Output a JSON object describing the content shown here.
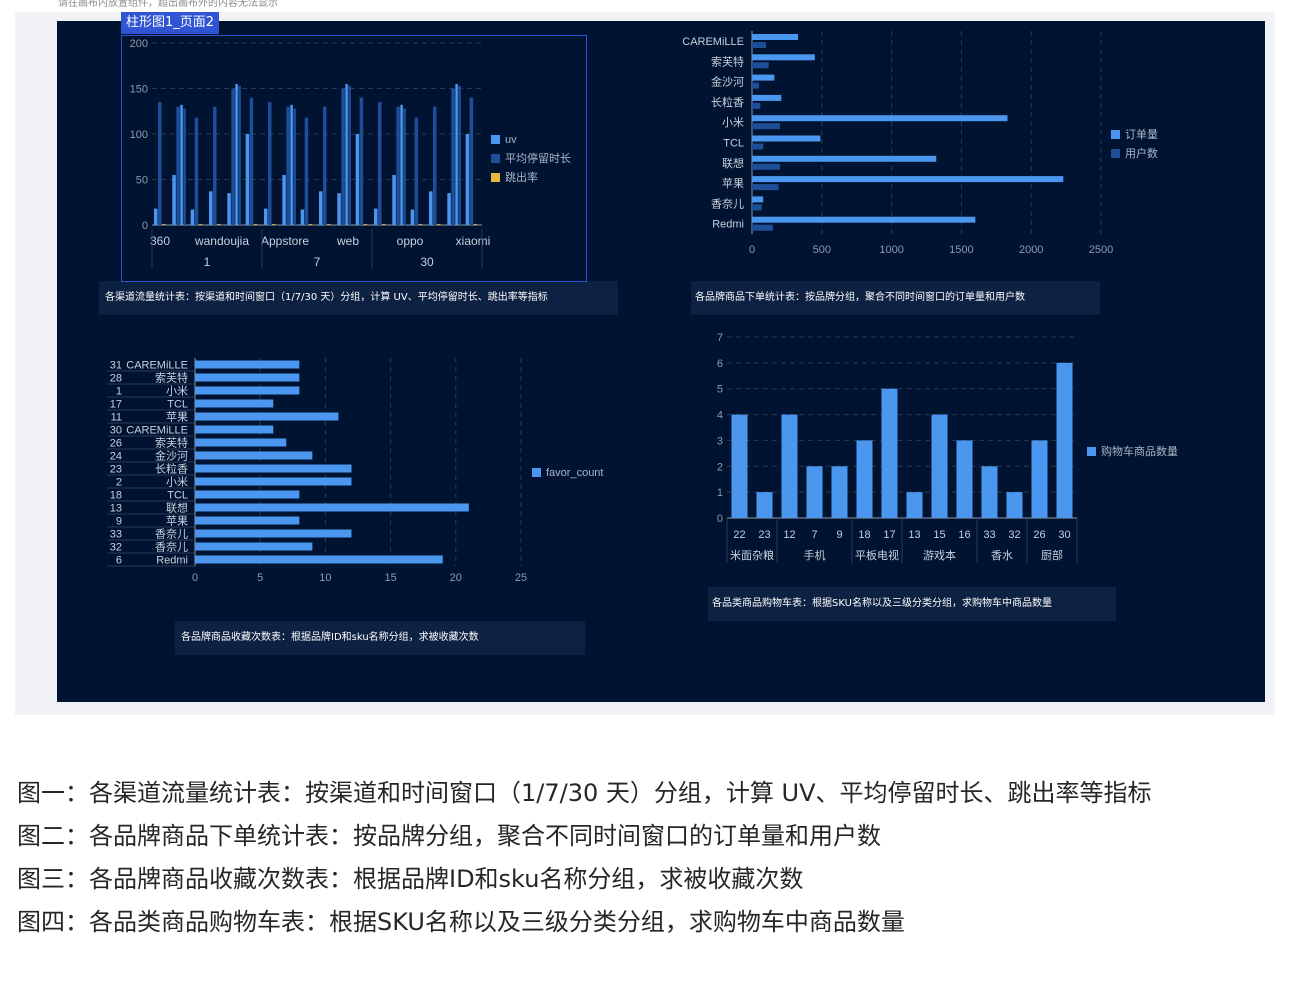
{
  "hint": "请在画布内放置组件，超出画布外的内容无法显示",
  "selected_label": "柱形图1_页面2",
  "colors": {
    "c1": "#4b97ef",
    "c2": "#1f4e99",
    "c3": "#e5b940",
    "axis": "#8e9aab",
    "grid": "#2a3a55"
  },
  "captions": {
    "c1": "各渠道流量统计表：按渠道和时间窗口（1/7/30 天）分组，计算 UV、平均停留时长、跳出率等指标",
    "c2": "各品牌商品下单统计表：按品牌分组，聚合不同时间窗口的订单量和用户数",
    "c3": "各品牌商品收藏次数表：根据品牌ID和sku名称分组，求被收藏次数",
    "c4": "各品类商品购物车表：根据SKU名称以及三级分类分组，求购物车中商品数量"
  },
  "descriptions": [
    "图一：各渠道流量统计表：按渠道和时间窗口（1/7/30 天）分组，计算 UV、平均停留时长、跳出率等指标",
    "图二：各品牌商品下单统计表：按品牌分组，聚合不同时间窗口的订单量和用户数",
    "图三：各品牌商品收藏次数表：根据品牌ID和sku名称分组，求被收藏次数",
    "图四：各品类商品购物车表：根据SKU名称以及三级分类分组，求购物车中商品数量"
  ],
  "chart_data": [
    {
      "type": "bar",
      "ylim": [
        0,
        200
      ],
      "yticks": [
        0,
        50,
        100,
        150,
        200
      ],
      "channel_labels": [
        "360",
        "wandoujia",
        "Appstore",
        "web",
        "oppo",
        "xiaomi"
      ],
      "group_labels": [
        "1",
        "7",
        "30"
      ],
      "series": [
        {
          "name": "uv",
          "values": [
            18,
            55,
            17,
            37,
            35,
            100,
            18,
            55,
            17,
            37,
            35,
            100,
            18,
            55,
            17,
            37,
            35,
            100
          ]
        },
        {
          "name": "平均停留时长",
          "values": [
            135,
            130,
            118,
            130,
            150,
            140,
            135,
            130,
            118,
            130,
            150,
            140,
            135,
            130,
            118,
            130,
            150,
            140
          ]
        },
        {
          "name": "跳出率",
          "values": [
            1,
            1,
            1,
            1,
            1,
            1,
            1,
            1,
            1,
            1,
            1,
            1,
            1,
            1,
            1,
            1,
            1,
            1
          ]
        }
      ],
      "extra_bars": [
        [
          132,
          128
        ],
        [
          155,
          153
        ],
        [
          132,
          128
        ],
        [
          155,
          153
        ],
        [
          132,
          128
        ],
        [
          155,
          153
        ]
      ],
      "legend_position": "right",
      "grid": true
    },
    {
      "type": "bar",
      "orientation": "horizontal",
      "categories": [
        "CAREMiLLE",
        "索芙特",
        "金沙河",
        "长粒香",
        "小米",
        "TCL",
        "联想",
        "苹果",
        "香奈儿",
        "Redmi"
      ],
      "series": [
        {
          "name": "订单量",
          "values": [
            330,
            450,
            160,
            210,
            1830,
            490,
            1320,
            2230,
            80,
            1600
          ]
        },
        {
          "name": "用户数",
          "values": [
            100,
            120,
            50,
            60,
            200,
            80,
            200,
            190,
            70,
            150
          ]
        }
      ],
      "xlim": [
        0,
        2500
      ],
      "xticks": [
        0,
        500,
        1000,
        1500,
        2000,
        2500
      ],
      "legend_position": "right",
      "grid": true
    },
    {
      "type": "bar",
      "orientation": "horizontal",
      "ids": [
        "31",
        "28",
        "1",
        "17",
        "11",
        "30",
        "26",
        "24",
        "23",
        "2",
        "18",
        "13",
        "9",
        "33",
        "32",
        "6"
      ],
      "categories": [
        "CAREMiLLE",
        "索芙特",
        "小米",
        "TCL",
        "苹果",
        "CAREMiLLE",
        "索芙特",
        "金沙河",
        "长粒香",
        "小米",
        "TCL",
        "联想",
        "苹果",
        "香奈儿",
        "香奈儿",
        "Redmi"
      ],
      "series": [
        {
          "name": "favor_count",
          "values": [
            8,
            8,
            8,
            6,
            11,
            6,
            7,
            9,
            12,
            12,
            8,
            21,
            8,
            12,
            9,
            19
          ]
        }
      ],
      "xlim": [
        0,
        25
      ],
      "xticks": [
        0,
        5,
        10,
        15,
        20,
        25
      ],
      "legend_position": "right",
      "grid": true
    },
    {
      "type": "bar",
      "categories": [
        "22",
        "23",
        "12",
        "7",
        "9",
        "18",
        "17",
        "13",
        "15",
        "16",
        "33",
        "32",
        "26",
        "30"
      ],
      "groups": [
        {
          "label": "米面杂粮",
          "count": 2
        },
        {
          "label": "手机",
          "count": 3
        },
        {
          "label": "平板电视",
          "count": 2
        },
        {
          "label": "游戏本",
          "count": 3
        },
        {
          "label": "香水",
          "count": 2
        },
        {
          "label": "厨部",
          "count": 2
        }
      ],
      "series": [
        {
          "name": "购物车商品数量",
          "values": [
            4,
            1,
            4,
            2,
            2,
            3,
            5,
            1,
            4,
            3,
            2,
            1,
            3,
            6
          ]
        }
      ],
      "ylim": [
        0,
        7
      ],
      "yticks": [
        0,
        1,
        2,
        3,
        4,
        5,
        6,
        7
      ],
      "legend_position": "right",
      "grid": true
    }
  ]
}
